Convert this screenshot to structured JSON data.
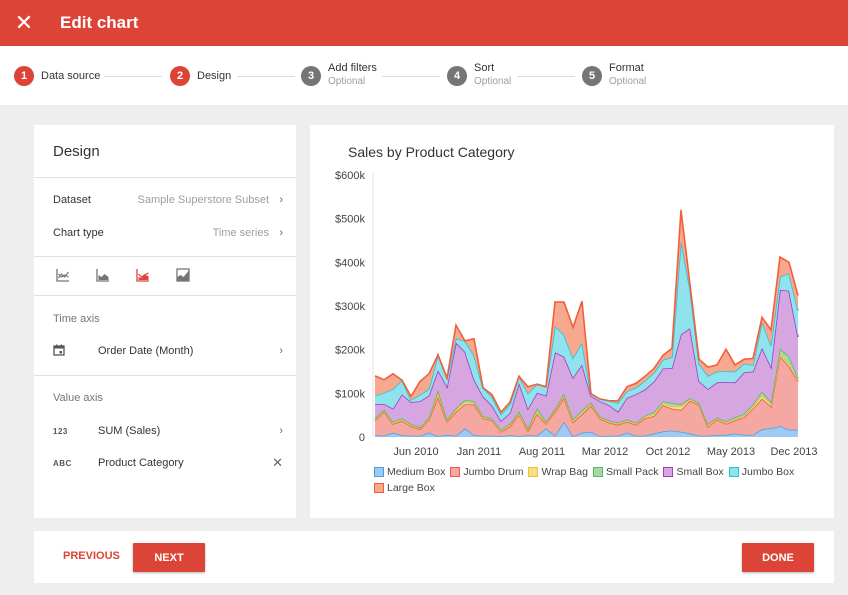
{
  "header": {
    "title": "Edit chart",
    "close_icon": "close-icon"
  },
  "stepper": {
    "steps": [
      {
        "num": "1",
        "label": "Data source",
        "sub": "",
        "state": "done"
      },
      {
        "num": "2",
        "label": "Design",
        "sub": "",
        "state": "current"
      },
      {
        "num": "3",
        "label": "Add filters",
        "sub": "Optional",
        "state": "todo"
      },
      {
        "num": "4",
        "label": "Sort",
        "sub": "Optional",
        "state": "todo"
      },
      {
        "num": "5",
        "label": "Format",
        "sub": "Optional",
        "state": "todo"
      }
    ]
  },
  "design": {
    "title": "Design",
    "dataset_label": "Dataset",
    "dataset_value": "Sample Superstore Subset",
    "chart_type_label": "Chart type",
    "chart_type_value": "Time series",
    "chart_variants": [
      "line-chart-icon",
      "area-chart-icon",
      "stacked-area-chart-icon",
      "filled-area-chart-icon"
    ],
    "selected_variant": "stacked-area-chart-icon",
    "time_axis_label": "Time axis",
    "time_axis_field": "Order Date (Month)",
    "time_axis_icon": "calendar-icon",
    "value_axis_label": "Value axis",
    "value_fields": [
      {
        "type_badge": "123",
        "name": "SUM (Sales)",
        "action": "chevron-right-icon"
      },
      {
        "type_badge": "ABC",
        "name": "Product Category",
        "action": "close-icon"
      }
    ]
  },
  "chart_data": {
    "type": "area",
    "stacked": true,
    "title": "Sales by Product Category",
    "xlabel": "",
    "ylabel": "",
    "ylim": [
      0,
      600000
    ],
    "y_ticks": [
      0,
      100000,
      200000,
      300000,
      400000,
      500000,
      600000
    ],
    "y_tick_labels": [
      "0",
      "$100k",
      "$200k",
      "$300k",
      "$400k",
      "$500k",
      "$600k"
    ],
    "x_tick_labels": [
      "Jun 2010",
      "Jan 2011",
      "Aug 2011",
      "Mar 2012",
      "Oct 2012",
      "May 2013",
      "Dec 2013"
    ],
    "x_tick_indices": [
      5,
      12,
      19,
      26,
      33,
      40,
      47
    ],
    "x_start": "Jan 2010",
    "x_end": "Dec 2013",
    "grid": false,
    "legend_position": "bottom",
    "series": [
      {
        "name": "Medium Box",
        "color": "#4e9de6",
        "fill": "#9ccaf3",
        "values": [
          4000,
          3000,
          10000,
          4000,
          3000,
          3000,
          10000,
          2000,
          5000,
          3000,
          20000,
          4000,
          3000,
          3000,
          2000,
          4000,
          2000,
          4000,
          3000,
          20000,
          3000,
          35000,
          2000,
          10000,
          12000,
          2000,
          3000,
          3000,
          10000,
          3000,
          3000,
          8000,
          13000,
          15000,
          12000,
          8000,
          3000,
          3000,
          5000,
          5000,
          8000,
          5000,
          5000,
          18000,
          20000,
          25000,
          17000,
          17000
        ]
      },
      {
        "name": "Jumbo Drum",
        "color": "#e8584f",
        "fill": "#f4a8a1",
        "values": [
          33000,
          55000,
          20000,
          33000,
          22000,
          15000,
          30000,
          90000,
          30000,
          55000,
          55000,
          70000,
          40000,
          35000,
          10000,
          20000,
          50000,
          10000,
          50000,
          10000,
          55000,
          55000,
          32000,
          42000,
          60000,
          40000,
          30000,
          25000,
          25000,
          25000,
          40000,
          40000,
          60000,
          50000,
          50000,
          75000,
          70000,
          20000,
          35000,
          25000,
          30000,
          40000,
          60000,
          70000,
          50000,
          160000,
          145000,
          110000
        ]
      },
      {
        "name": "Wrap Bag",
        "color": "#f2c12e",
        "fill": "#f8dc88",
        "values": [
          2000,
          2000,
          2000,
          2000,
          2000,
          2000,
          2000,
          8000,
          2000,
          5000,
          5000,
          3000,
          2000,
          2000,
          2000,
          3000,
          2000,
          3000,
          5000,
          2000,
          3000,
          4000,
          3000,
          4000,
          3000,
          2000,
          2000,
          2000,
          2000,
          2000,
          3000,
          4000,
          4000,
          5000,
          8000,
          3000,
          2000,
          4000,
          2000,
          3000,
          2000,
          3000,
          5000,
          8000,
          5000,
          5000,
          5000,
          2000
        ]
      },
      {
        "name": "Small Pack",
        "color": "#5cb85c",
        "fill": "#a8d8a8",
        "values": [
          3000,
          3000,
          3000,
          4000,
          3000,
          2000,
          3000,
          8000,
          3000,
          3000,
          5000,
          5000,
          3000,
          2000,
          3000,
          3000,
          5000,
          3000,
          8000,
          3000,
          3000,
          5000,
          4000,
          5000,
          4000,
          3000,
          3000,
          3000,
          3000,
          3000,
          3000,
          5000,
          5000,
          8000,
          5000,
          3000,
          3000,
          3000,
          3000,
          3000,
          5000,
          5000,
          5000,
          8000,
          5000,
          12000,
          18000,
          5000
        ]
      },
      {
        "name": "Small Box",
        "color": "#a23cc0",
        "fill": "#d6a6e0",
        "values": [
          33000,
          13000,
          30000,
          55000,
          50000,
          60000,
          50000,
          45000,
          75000,
          150000,
          110000,
          50000,
          45000,
          30000,
          20000,
          25000,
          65000,
          45000,
          35000,
          60000,
          130000,
          85000,
          95000,
          105000,
          15000,
          35000,
          35000,
          25000,
          50000,
          65000,
          60000,
          70000,
          75000,
          80000,
          160000,
          160000,
          50000,
          80000,
          80000,
          90000,
          80000,
          95000,
          75000,
          100000,
          80000,
          135000,
          150000,
          95000
        ]
      },
      {
        "name": "Jumbo Box",
        "color": "#29c3d4",
        "fill": "#8ee3ec",
        "values": [
          20000,
          25000,
          45000,
          32000,
          5000,
          15000,
          15000,
          35000,
          20000,
          10000,
          25000,
          55000,
          20000,
          20000,
          15000,
          20000,
          15000,
          35000,
          20000,
          20000,
          60000,
          50000,
          45000,
          50000,
          5000,
          5000,
          10000,
          20000,
          15000,
          15000,
          20000,
          20000,
          20000,
          25000,
          215000,
          90000,
          40000,
          30000,
          25000,
          25000,
          25000,
          20000,
          15000,
          60000,
          50000,
          30000,
          40000,
          60000
        ]
      },
      {
        "name": "Large Box",
        "color": "#f2603a",
        "fill": "#f7a990",
        "values": [
          45000,
          30000,
          35000,
          0,
          8000,
          30000,
          35000,
          0,
          0,
          30000,
          0,
          38000,
          0,
          5000,
          5000,
          5000,
          0,
          15000,
          0,
          0,
          55000,
          75000,
          70000,
          95000,
          0,
          0,
          0,
          5000,
          10000,
          10000,
          10000,
          10000,
          10000,
          20000,
          70000,
          10000,
          10000,
          20000,
          15000,
          50000,
          15000,
          10000,
          15000,
          10000,
          35000,
          45000,
          25000,
          35000
        ]
      }
    ]
  },
  "footer": {
    "previous_label": "PREVIOUS",
    "next_label": "NEXT",
    "done_label": "DONE"
  }
}
